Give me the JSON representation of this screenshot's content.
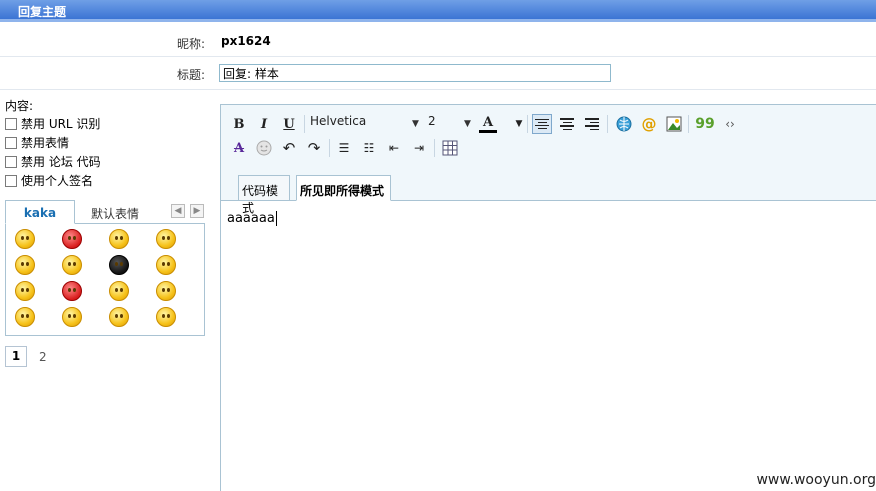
{
  "header": {
    "title": "回复主题"
  },
  "form": {
    "nickname_label": "昵称:",
    "nickname_value": "px1624",
    "subject_label": "标题:",
    "subject_value": "回复: 样本",
    "content_label": "内容:"
  },
  "options": [
    {
      "label": "禁用 URL 识别",
      "checked": false
    },
    {
      "label": "禁用表情",
      "checked": false
    },
    {
      "label": "禁用 论坛 代码",
      "checked": false
    },
    {
      "label": "使用个人签名",
      "checked": false
    }
  ],
  "smilies": {
    "tabs": [
      "kaka",
      "默认表情"
    ],
    "active_tab": "kaka",
    "prev_icon": "chevron-left-icon",
    "next_icon": "chevron-right-icon",
    "count": 16
  },
  "pager": {
    "current": "1",
    "next": "2"
  },
  "toolbar": {
    "bold": "B",
    "italic": "I",
    "underline": "U",
    "font_family": "Helvetica",
    "font_size": "2",
    "text_color_glyph": "A",
    "quote_glyph": "99",
    "code_glyph": "‹›"
  },
  "editor": {
    "tabs": [
      "代码模式",
      "所见即所得模式"
    ],
    "active_tab": "所见即所得模式",
    "content": "aaaaaa"
  },
  "watermark": "www.wooyun.org",
  "colors": {
    "header_blue": "#3b74d4",
    "accent_blue": "#1a6fb2",
    "border": "#a9c3d3"
  }
}
